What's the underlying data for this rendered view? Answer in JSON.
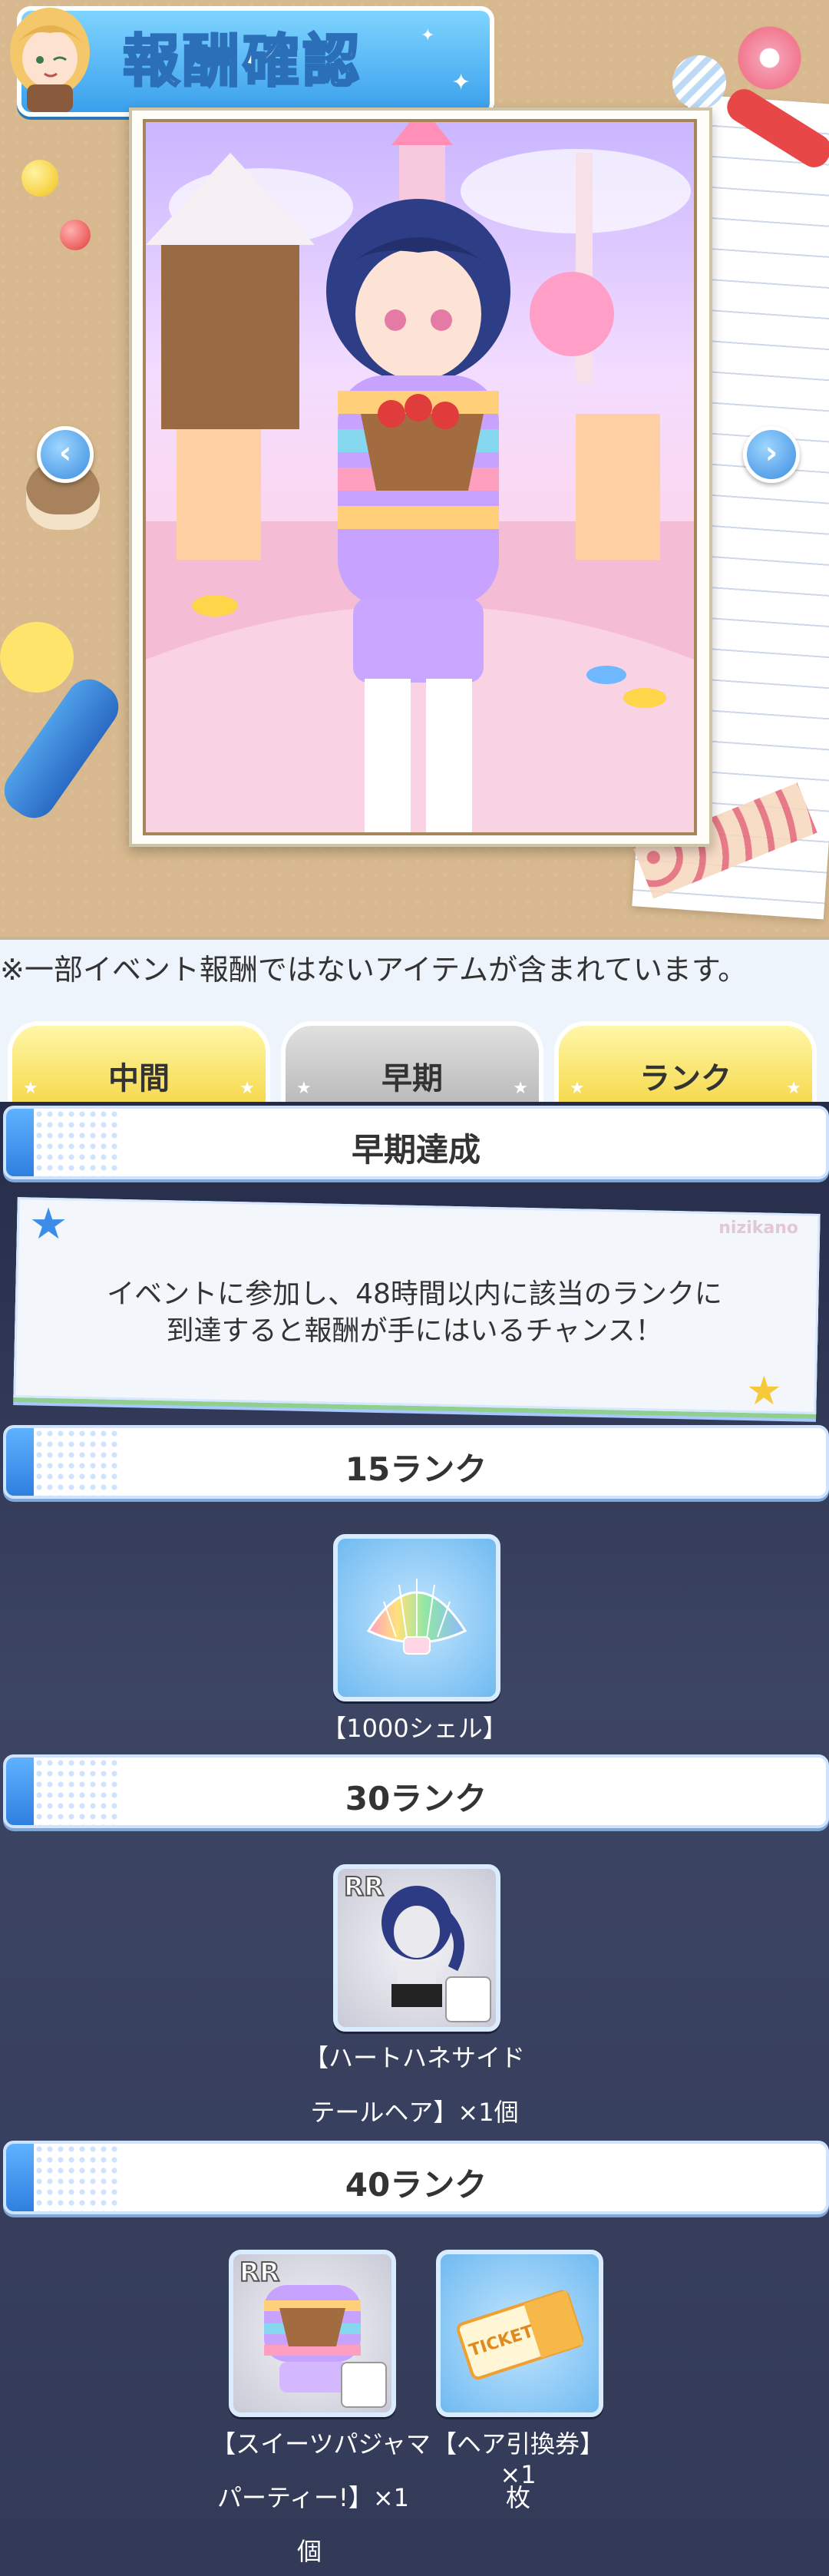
{
  "header": {
    "title": "報酬確認"
  },
  "notice": "※一部イベント報酬ではないアイテムが含まれています。",
  "tabs": [
    {
      "label": "中間",
      "active": false
    },
    {
      "label": "早期",
      "active": true
    },
    {
      "label": "ランク",
      "active": false
    }
  ],
  "section": {
    "title": "早期達成",
    "description_line1": "イベントに参加し、48時間以内に該当のランクに",
    "description_line2": "到達すると報酬が手にはいるチャンス！"
  },
  "ranks": [
    {
      "title": "15ランク",
      "items": [
        {
          "icon": "shell-icon",
          "label": "【1000シェル】"
        }
      ]
    },
    {
      "title": "30ランク",
      "items": [
        {
          "icon": "hair-icon",
          "rarity": "RR",
          "label_line1": "【ハートハネサイド",
          "label_line2": "テールヘア】×1個"
        }
      ]
    },
    {
      "title": "40ランク",
      "items": [
        {
          "icon": "outfit-icon",
          "rarity": "RR",
          "label_line1": "【スイーツパジャマ",
          "label_line2": "パーティー!】×1",
          "label_line3": "個"
        },
        {
          "icon": "ticket-icon",
          "label_line1": "【ヘア引換券】×1",
          "label_line2": "枚",
          "ticket_text": "TICKET"
        }
      ]
    }
  ],
  "icons": {
    "prev": "chevron-left-icon",
    "next": "chevron-right-icon"
  },
  "colors": {
    "accent_blue": "#3aa0ec",
    "tab_gold": "#f5d84a",
    "background": "#3c4563"
  }
}
